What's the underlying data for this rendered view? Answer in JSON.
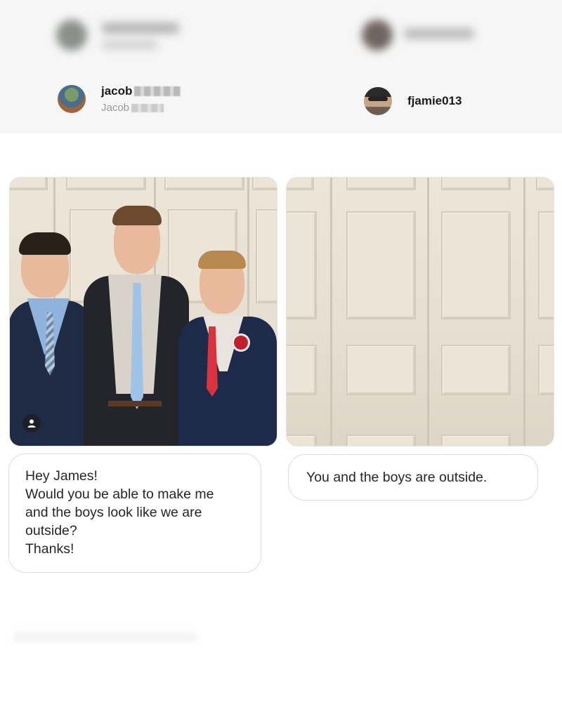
{
  "left_user": {
    "username": "jacob",
    "fullname": "Jacob"
  },
  "right_user": {
    "username": "fjamie013"
  },
  "left_message": {
    "lines": [
      "Hey James!",
      "Would you be able to make me",
      "and the boys look like we are",
      "outside?",
      "Thanks!"
    ]
  },
  "right_message": {
    "text": "You and the boys are outside."
  },
  "icons": {
    "left_photo_badge": "person-icon"
  },
  "colors": {
    "header_bg": "#f6f6f6",
    "bubble_border": "#dcdcdc",
    "wall": "#ebe4d7",
    "red_tie": "#d8333f",
    "blue_tie": "#a9c8e8"
  }
}
